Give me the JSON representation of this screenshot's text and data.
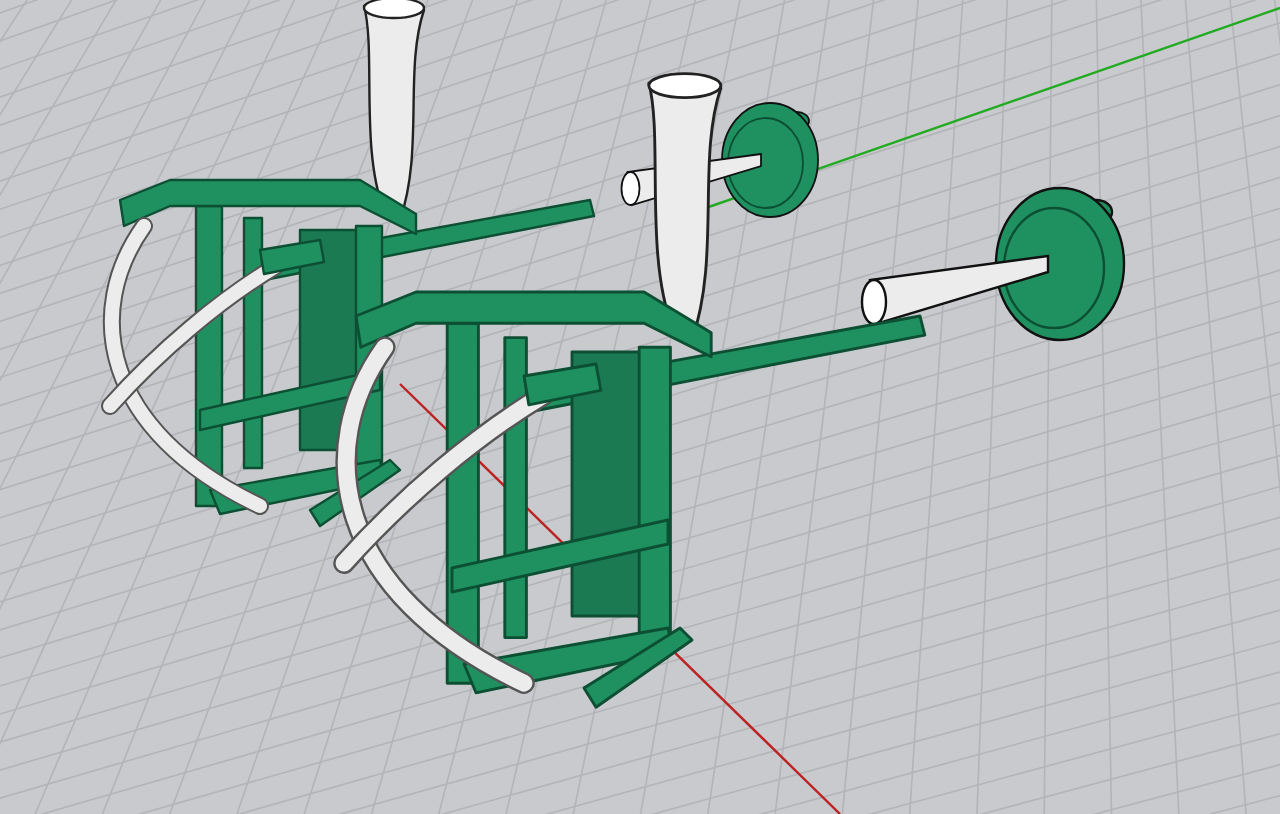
{
  "viewport": {
    "kind": "perspective"
  },
  "objects": [
    {
      "kind": "disc"
    },
    {
      "kind": "disc"
    },
    {
      "kind": "frame"
    },
    {
      "kind": "frame"
    }
  ]
}
